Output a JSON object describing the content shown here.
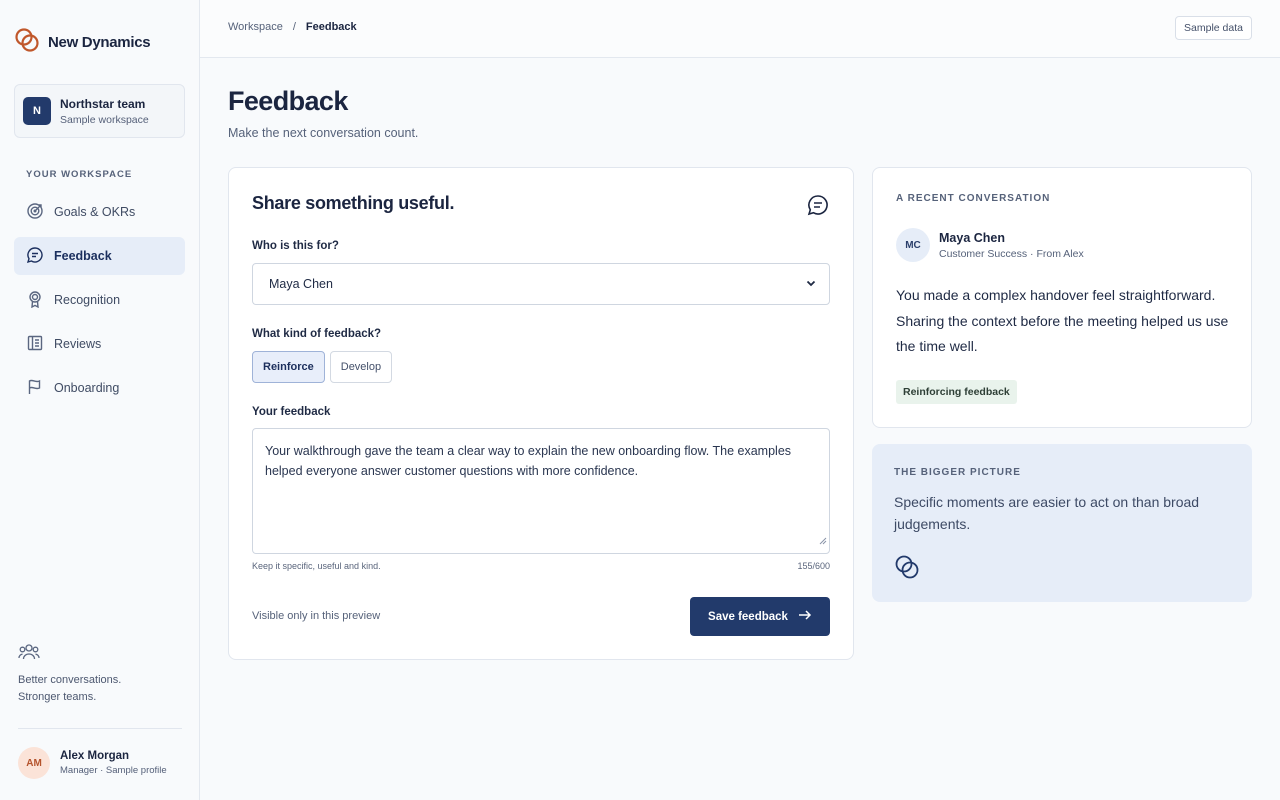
{
  "brand": {
    "name": "New Dynamics"
  },
  "team": {
    "initial": "N",
    "name": "Northstar team",
    "subtitle": "Sample workspace"
  },
  "sidebar": {
    "section_label": "YOUR WORKSPACE",
    "items": [
      {
        "label": "Goals & OKRs",
        "icon": "target-icon",
        "active": false
      },
      {
        "label": "Feedback",
        "icon": "chat-bubble-icon",
        "active": true
      },
      {
        "label": "Recognition",
        "icon": "award-icon",
        "active": false
      },
      {
        "label": "Reviews",
        "icon": "document-icon",
        "active": false
      },
      {
        "label": "Onboarding",
        "icon": "flag-icon",
        "active": false
      }
    ],
    "tagline_line1": "Better conversations.",
    "tagline_line2": "Stronger teams."
  },
  "profile": {
    "initials": "AM",
    "name": "Alex Morgan",
    "role": "Manager · Sample profile"
  },
  "header": {
    "breadcrumb": [
      "Workspace",
      "Feedback"
    ],
    "breadcrumb_separator": "/",
    "sample_button": "Sample data"
  },
  "page": {
    "title": "Feedback",
    "subtitle": "Make the next conversation count."
  },
  "form": {
    "title": "Share something useful.",
    "recipient_label": "Who is this for?",
    "recipient_value": "Maya Chen",
    "kind_label": "What kind of feedback?",
    "kind_options": [
      "Reinforce",
      "Develop"
    ],
    "kind_selected": "Reinforce",
    "feedback_label": "Your feedback",
    "feedback_value": "Your walkthrough gave the team a clear way to explain the new onboarding flow. The examples helped everyone answer customer questions with more confidence.",
    "hint": "Keep it specific, useful and kind.",
    "counter": "155/600",
    "visibility_note": "Visible only in this preview",
    "save_label": "Save feedback"
  },
  "recent": {
    "eyebrow": "A RECENT CONVERSATION",
    "initials": "MC",
    "name": "Maya Chen",
    "meta": "Customer Success · From Alex",
    "quote": "You made a complex handover feel straightforward. Sharing the context before the meeting helped us use the time well.",
    "tag": "Reinforcing feedback"
  },
  "bigger_picture": {
    "eyebrow": "THE BIGGER PICTURE",
    "text": "Specific moments are easier to act on than broad judgements."
  },
  "colors": {
    "accent": "#223a6b",
    "brand": "#c0572b",
    "active_nav_bg": "#e6edf8",
    "tag_bg": "#e9f3ec"
  }
}
